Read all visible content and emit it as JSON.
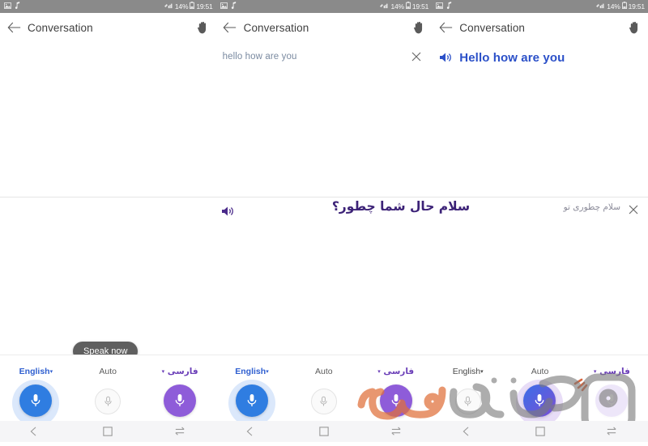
{
  "statusbar": {
    "left_icons": [
      "image-icon",
      "music-note-icon"
    ],
    "signal_icon": "wifi-signal-icon",
    "battery_percent": "14%",
    "battery_icon": "battery-icon",
    "time": "19:51"
  },
  "appbar": {
    "back_icon": "back-arrow-icon",
    "title": "Conversation",
    "hand_icon": "hand-icon"
  },
  "panels": [
    {
      "id": "panel-1",
      "source_text": "",
      "result_text": "",
      "tooltip": "Speak now"
    },
    {
      "id": "panel-2",
      "source_text": "hello how are you",
      "clear_icon": "close-icon"
    },
    {
      "id": "panel-3",
      "speaker_icon": "speaker-icon",
      "result_text": "Hello how are you"
    }
  ],
  "translation_row": {
    "speaker_icon": "speaker-icon",
    "translated_text": "سلام حال شما چطور؟",
    "interim_text": "سلام چطوری تو",
    "clear_icon": "close-icon"
  },
  "mic_controls": {
    "panel1": [
      {
        "label": "English",
        "caret": "▾",
        "state": "active",
        "color": "#2f7de1",
        "halo": "#dbe8fb",
        "icon": "microphone-icon"
      },
      {
        "label": "Auto",
        "caret": "",
        "state": "idle",
        "color": "#9a9a9a",
        "halo": "none",
        "icon": "microphone-icon"
      },
      {
        "label": "فارسی",
        "caret": "▾",
        "state": "active",
        "color": "#8e5cd9",
        "halo": "none",
        "icon": "microphone-icon"
      }
    ],
    "panel2": [
      {
        "label": "English",
        "caret": "▾",
        "state": "active",
        "color": "#2f7de1",
        "halo": "#dbe8fb",
        "icon": "microphone-icon"
      },
      {
        "label": "Auto",
        "caret": "",
        "state": "idle",
        "color": "#9a9a9a",
        "halo": "none",
        "icon": "microphone-icon"
      },
      {
        "label": "فارسی",
        "caret": "▾",
        "state": "active",
        "color": "#8e5cd9",
        "halo": "none",
        "icon": "microphone-icon"
      }
    ],
    "panel3": [
      {
        "label": "English",
        "caret": "▾",
        "state": "idle",
        "color": "#9a9a9a",
        "halo": "none",
        "icon": "microphone-icon"
      },
      {
        "label": "Auto",
        "caret": "",
        "state": "listening",
        "color": "#5a60dd",
        "halo": "#e8ddf7",
        "icon": "microphone-icon"
      },
      {
        "label": "فارسی",
        "caret": "▾",
        "state": "active",
        "color": "#8e5cd9",
        "halo": "none",
        "icon": "microphone-icon"
      }
    ]
  },
  "navbar": {
    "back_icon": "nav-back-icon",
    "recents_icon": "nav-recents-icon",
    "home_icon": "nav-home-icon"
  },
  "watermark": {
    "text_orange": "رسانی",
    "text_gray": "آگهی",
    "text_gray2": "و",
    "color_orange": "#e0703a",
    "color_gray": "#7b7b7b"
  }
}
